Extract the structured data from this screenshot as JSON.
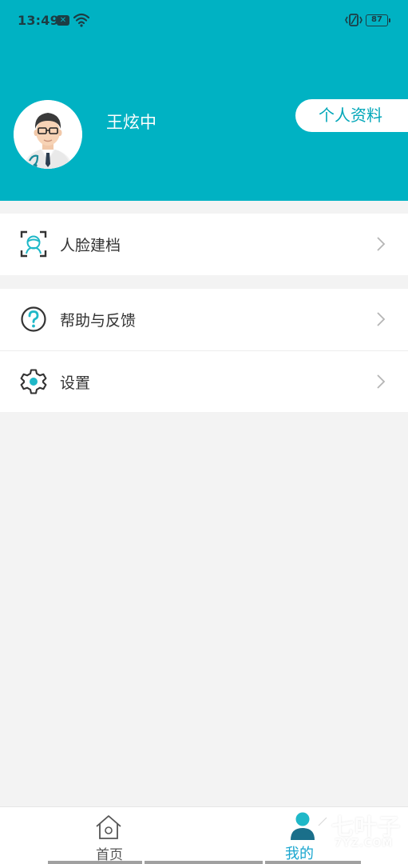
{
  "status_bar": {
    "time": "13:49",
    "msg_badge": "✕",
    "battery": "87",
    "icons": [
      "message-icon",
      "wifi-icon",
      "vibrate-icon",
      "battery-icon"
    ]
  },
  "profile": {
    "name": "王炫中",
    "profile_button": "个人资料",
    "header_color": "#00b2c3"
  },
  "menu": {
    "face_record": "人脸建档",
    "help_feedback": "帮助与反馈",
    "settings": "设置",
    "icons": [
      "face-scan-icon",
      "help-icon",
      "gear-icon",
      "chevron-right-icon"
    ]
  },
  "tab_bar": {
    "home": "首页",
    "mine": "我的",
    "active_tab": "mine",
    "active_color": "#1aa6cf"
  },
  "watermark": {
    "title": "七叶子",
    "url": "7YZ.COM"
  }
}
